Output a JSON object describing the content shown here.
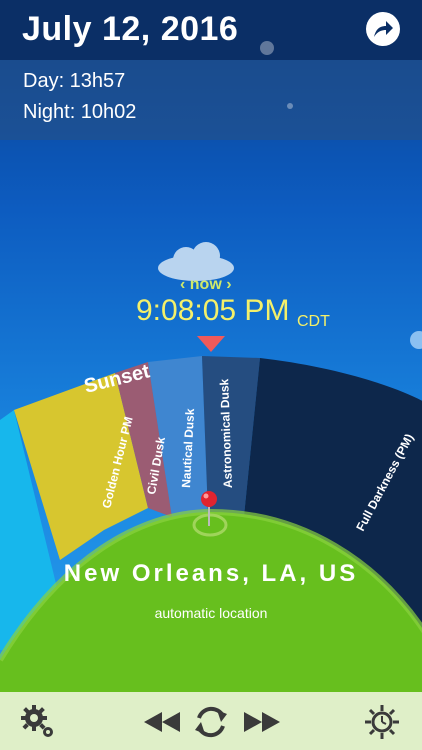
{
  "header": {
    "date": "July 12, 2016"
  },
  "daynight": {
    "day": "Day: 13h57",
    "night": "Night: 10h02"
  },
  "now": {
    "label": "‹ now ›",
    "time": "9:08:05 PM",
    "timezone": "CDT"
  },
  "segments": {
    "sunset": "Sunset",
    "golden_hour_pm": "Golden Hour PM",
    "civil_dusk": "Civil Dusk",
    "nautical_dusk": "Nautical Dusk",
    "astronomical_dusk": "Astronomical Dusk",
    "full_darkness_pm": "Full Darkness (PM)"
  },
  "location": {
    "name": "New Orleans, LA, US",
    "subtitle": "automatic location"
  },
  "toolbar": {
    "settings": "gear-icon",
    "rewind": "rewind-icon",
    "refresh": "refresh-icon",
    "fast_forward": "fast-forward-icon",
    "sun_settings": "sun-icon"
  },
  "colors": {
    "header": "#0b2f66",
    "golden": "#d7c62f",
    "civil": "#9b5c73",
    "nautical": "#3f86d0",
    "astronomical": "#254d80",
    "darkness": "#0d274b",
    "day": "#17b7ec",
    "ground": "#67bf1e",
    "toolbar": "#dfefc8"
  }
}
